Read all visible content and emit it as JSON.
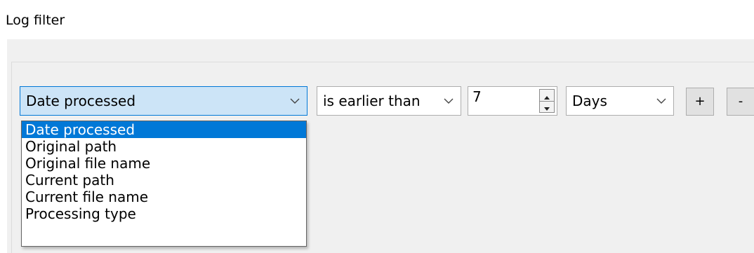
{
  "window": {
    "title": "Log filter"
  },
  "filter_row": {
    "field": {
      "selected": "Date processed"
    },
    "operator": {
      "selected": "is earlier than"
    },
    "amount": {
      "value": "7"
    },
    "unit": {
      "selected": "Days"
    },
    "add_label": "+",
    "remove_label": "-"
  },
  "field_dropdown": {
    "options": [
      "Date processed",
      "Original path",
      "Original file name",
      "Current path",
      "Current file name",
      "Processing type"
    ],
    "highlighted_index": 0
  },
  "colors": {
    "accent": "#0078d7",
    "open_combo_bg": "#cce4f7",
    "panel_bg": "#f0f0f0"
  }
}
